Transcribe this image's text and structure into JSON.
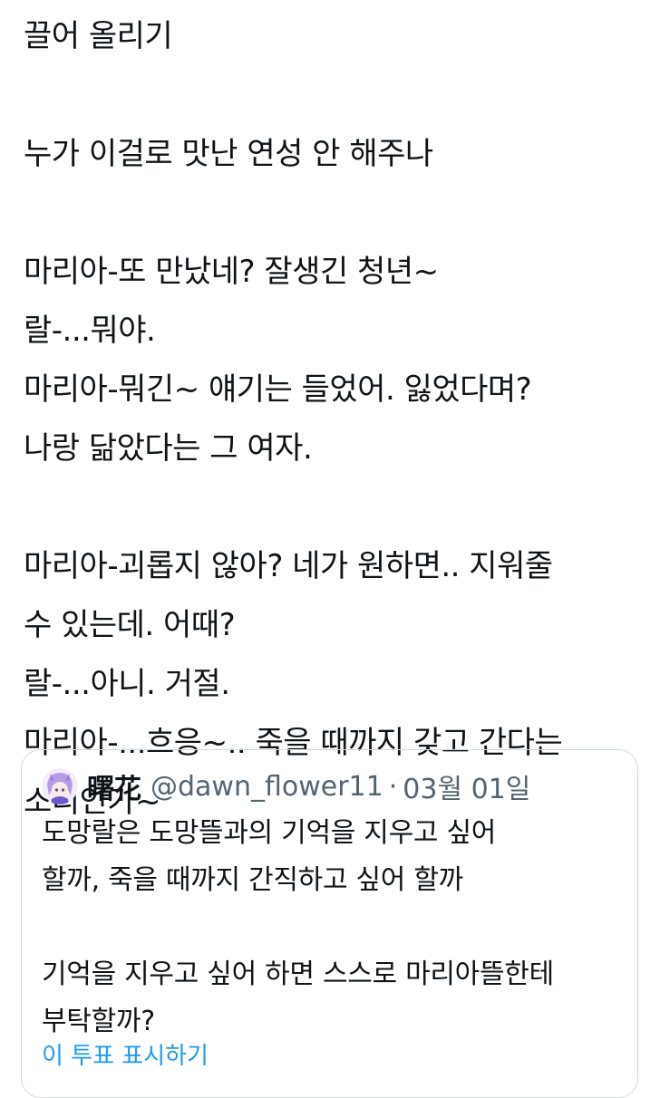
{
  "tweet": {
    "lines": [
      "끌어 올리기",
      "",
      "누가 이걸로 맛난 연성 안 해주나",
      "",
      "마리아-또 만났네? 잘생긴 청년~",
      "랄-...뭐야.",
      "마리아-뭐긴~ 얘기는 들었어. 잃었다며?",
      "나랑 닮았다는 그 여자.",
      "",
      "마리아-괴롭지 않아? 네가 원하면.. 지워줄",
      "수 있는데. 어때?",
      "랄-...아니. 거절.",
      "마리아-...흐응~.. 죽을 때까지 갖고 간다는",
      "소리인가~"
    ]
  },
  "quote": {
    "avatar_icon": "anime-avatar-icon",
    "name": "曙花",
    "handle": "@dawn_flower11",
    "separator": "·",
    "date": "03월 01일",
    "lines": [
      "도망랄은 도망뜰과의 기억을 지우고 싶어",
      "할까, 죽을 때까지 간직하고 싶어 할까",
      "",
      "기억을 지우고 싶어 하면 스스로 마리아뜰한테",
      "부탁할까?"
    ],
    "show_poll_label": "이 투표 표시하기"
  },
  "colors": {
    "text": "#0f1419",
    "secondary": "#536471",
    "link": "#1d9bf0",
    "border": "#cfd9de"
  }
}
